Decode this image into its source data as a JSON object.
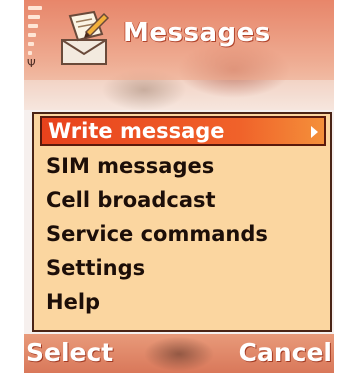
{
  "header": {
    "title": "Messages",
    "app_icon": "envelope-write-icon",
    "signal_icon": "antenna-icon"
  },
  "menu": {
    "items": [
      {
        "label": "Write message",
        "selected": true,
        "has_submenu": true
      },
      {
        "label": "SIM messages"
      },
      {
        "label": "Cell broadcast"
      },
      {
        "label": "Service commands"
      },
      {
        "label": "Settings"
      },
      {
        "label": "Help"
      }
    ]
  },
  "softkeys": {
    "left": "Select",
    "right": "Cancel"
  },
  "colors": {
    "highlight": "#e8421c",
    "panel": "#fbd6a0",
    "header": "#e7785a"
  }
}
